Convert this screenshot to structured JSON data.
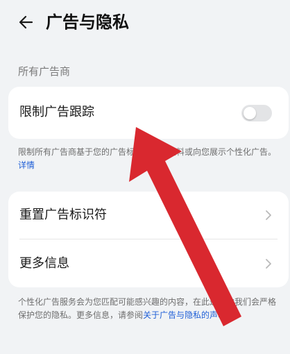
{
  "header": {
    "back_icon": "arrow-left-icon",
    "title": "广告与隐私"
  },
  "section": {
    "label": "所有广告商"
  },
  "limit_tracking": {
    "label": "限制广告跟踪",
    "toggle_state": "off",
    "description_prefix": "限制所有广告商基于您的广告标",
    "description_hidden_mid": "识符",
    "description_suffix": "个人资料或向您展示个性化广告。",
    "details_link": "详情"
  },
  "list": {
    "items": [
      {
        "label": "重置广告标识符",
        "icon": "chevron-right-icon"
      },
      {
        "label": "更多信息",
        "icon": "chevron-right-icon"
      }
    ]
  },
  "footer": {
    "text_prefix": "个性化广告服务会为您匹配可能感兴趣的内容，在此过程中我们会严格保护您的隐私。更多信息，请参阅",
    "link_text": "关于广告与隐私的声明",
    "text_suffix": "。"
  },
  "overlay": {
    "annotation_icon": "red-arrow-annotation",
    "color": "#d9282f"
  },
  "colors": {
    "background": "#f1f3f5",
    "card": "#ffffff",
    "link": "#1f5fd6",
    "toggle_off": "#e3e4e6"
  }
}
